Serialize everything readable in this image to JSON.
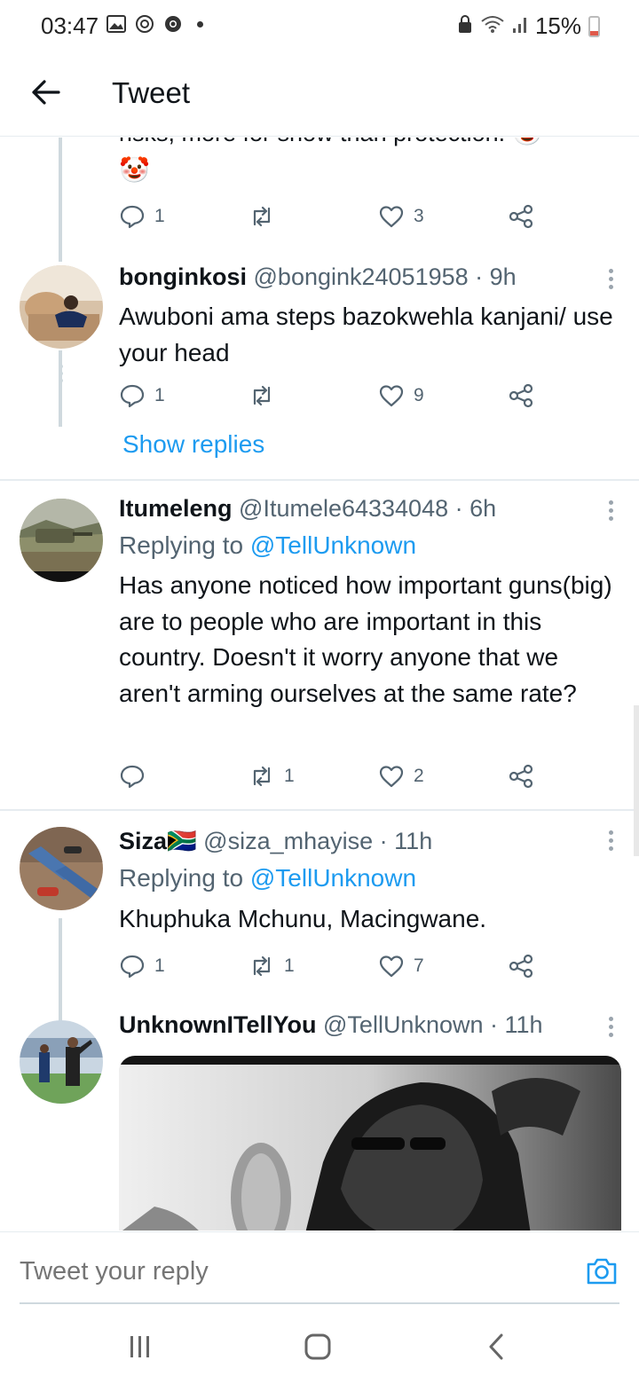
{
  "status_bar": {
    "time": "03:47",
    "battery": "15%"
  },
  "header": {
    "title": "Tweet"
  },
  "partial_tweet": {
    "clipped_text": "risks, more for show than protection.",
    "actions": {
      "replies": "1",
      "retweets": "",
      "likes": "3"
    }
  },
  "tweets": [
    {
      "name": "bonginkosi",
      "handle": "@bongink24051958",
      "time": "· 9h",
      "text": "Awuboni ama steps bazokwehla kanjani/ use your head",
      "actions": {
        "replies": "1",
        "retweets": "",
        "likes": "9"
      },
      "show_replies": "Show replies"
    },
    {
      "name": "Itumeleng",
      "handle": "@Itumele64334048",
      "time": "· 6h",
      "replying_prefix": "Replying to",
      "replying_to": "@TellUnknown",
      "text": "Has anyone noticed how important guns(big) are to people who are important in this country. Doesn't it worry anyone that we aren't arming ourselves at the same rate?",
      "actions": {
        "replies": "",
        "retweets": "1",
        "likes": "2"
      }
    },
    {
      "name": "Siza🇿🇦",
      "handle": "@siza_mhayise",
      "time": "· 11h",
      "replying_prefix": "Replying to",
      "replying_to": "@TellUnknown",
      "text": "Khuphuka Mchunu, Macingwane.",
      "actions": {
        "replies": "1",
        "retweets": "1",
        "likes": "7"
      }
    },
    {
      "name": "UnknownITellYou",
      "handle": "@TellUnknown",
      "time": "· 11h"
    }
  ],
  "reply_bar": {
    "placeholder": "Tweet your reply"
  },
  "colors": {
    "accent": "#1d9bf0",
    "secondary_text": "#536471",
    "thread_line": "#cfd9de"
  }
}
